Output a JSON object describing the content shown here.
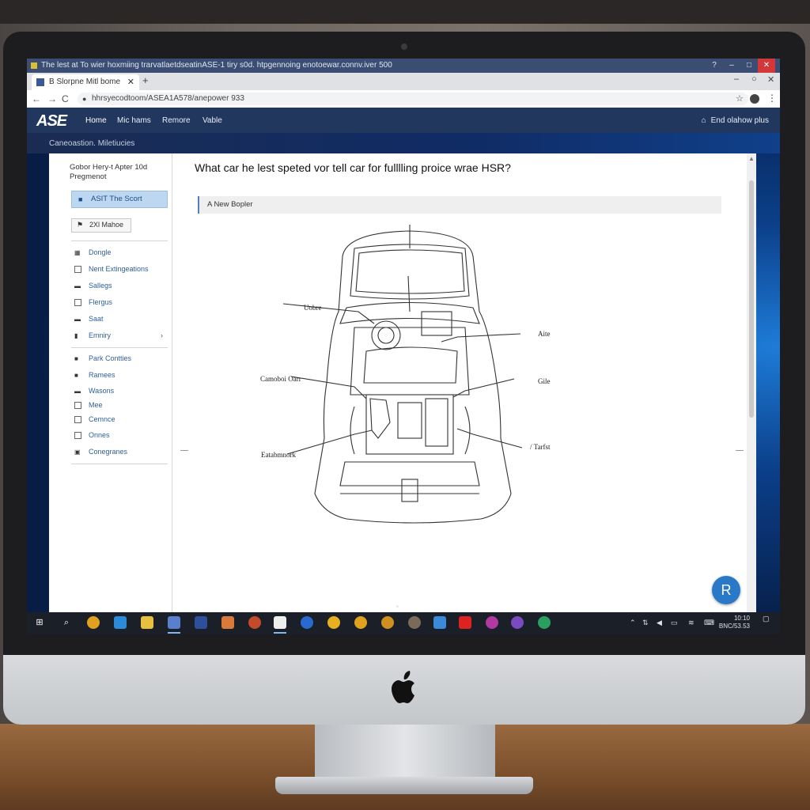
{
  "window": {
    "title": "The lest at To wier hoxmiing trarvatlaetdseatinASE-1 tiry s0d. htpgennoing enotoewar.connv.iver 500",
    "controls": [
      "?",
      "–",
      "□",
      "✕"
    ]
  },
  "browser": {
    "tab_title": "B Slorpne Mitl bome",
    "tab_close": "✕",
    "new_tab": "+",
    "url": "hhrsyecodtoom/ASEA1A578/anepower 933",
    "nav_icons": {
      "back": "←",
      "forward": "→",
      "reload": "C"
    }
  },
  "site": {
    "logo": "ASE",
    "nav": [
      "Home",
      "Mic hams",
      "Remore",
      "Vable"
    ],
    "nav_right": "End olahow plus",
    "breadcrumb": "Caneoastion. Miletiucies"
  },
  "sidebar": {
    "header": "Gobor Hery-t Apter 10d Pregmenot",
    "primary_button": "ASIT The Scort",
    "secondary_button": "2Xl Mahoe",
    "group1": [
      {
        "label": "Dongle",
        "icon": "fill"
      },
      {
        "label": "Nent Extingeations",
        "icon": "sq"
      },
      {
        "label": "Sallegs",
        "icon": "fill"
      },
      {
        "label": "Flergus",
        "icon": "sq"
      },
      {
        "label": "Saat",
        "icon": "fill"
      },
      {
        "label": "Emniry",
        "icon": "fill",
        "chevron": "›"
      }
    ],
    "group2": [
      {
        "label": "Park Contties",
        "icon": "fill"
      },
      {
        "label": "Ramees",
        "icon": "fill"
      },
      {
        "label": "Wasons",
        "icon": "dash"
      },
      {
        "label": "Mee",
        "icon": "sq"
      },
      {
        "label": "Cemnce",
        "icon": "sq"
      },
      {
        "label": "Onnes",
        "icon": "sq"
      },
      {
        "label": "Conegranes",
        "icon": "fill"
      }
    ]
  },
  "main": {
    "question": "What car he lest speted vor tell car for fulllling proice wrae HSR?",
    "answer_option": "A New Bopler",
    "diagram_labels": {
      "left_top": "Uobre",
      "left_mid": "Camoboi Oarr",
      "left_bottom": "Eatabmnork",
      "right_top": "Aite",
      "right_mid": "Gile",
      "right_bottom": "/ Tarfst"
    }
  },
  "fab_label": "R",
  "taskbar": {
    "clock_time": "10:10",
    "clock_date": "BNC/53.53"
  },
  "colors": {
    "site_nav": "#22375d",
    "primary_button": "#bcd7ef",
    "fab": "#2a79c9",
    "taskbar": "#1b1f27"
  }
}
